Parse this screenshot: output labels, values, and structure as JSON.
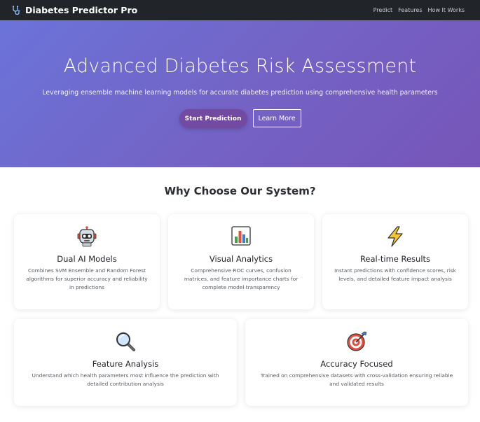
{
  "navbar": {
    "brand": "Diabetes Predictor Pro",
    "brand_icon": "stethoscope-icon",
    "links": [
      "Predict",
      "Features",
      "How It Works"
    ]
  },
  "hero": {
    "title": "Advanced Diabetes Risk Assessment",
    "subtitle": "Leveraging ensemble machine learning models for accurate diabetes prediction using comprehensive health parameters",
    "primary_button": "Start Prediction",
    "secondary_button": "Learn More"
  },
  "features": {
    "title": "Why Choose Our System?",
    "cards": [
      {
        "icon": "robot-icon",
        "title": "Dual AI Models",
        "description": "Combines SVM Ensemble and Random Forest algorithms for superior accuracy and reliability in predictions"
      },
      {
        "icon": "bar-chart-icon",
        "title": "Visual Analytics",
        "description": "Comprehensive ROC curves, confusion matrices, and feature importance charts for complete model transparency"
      },
      {
        "icon": "lightning-icon",
        "title": "Real-time Results",
        "description": "Instant predictions with confidence scores, risk levels, and detailed feature impact analysis"
      },
      {
        "icon": "magnifier-icon",
        "title": "Feature Analysis",
        "description": "Understand which health parameters most influence the prediction with detailed contribution analysis"
      },
      {
        "icon": "target-icon",
        "title": "Accuracy Focused",
        "description": "Trained on comprehensive datasets with cross-validation ensuring reliable and validated results"
      }
    ]
  },
  "colors": {
    "navbar": "#212529",
    "hero_gradient_start": "#6b73d9",
    "hero_gradient_end": "#7655b8",
    "primary_button": "#734aa2"
  }
}
